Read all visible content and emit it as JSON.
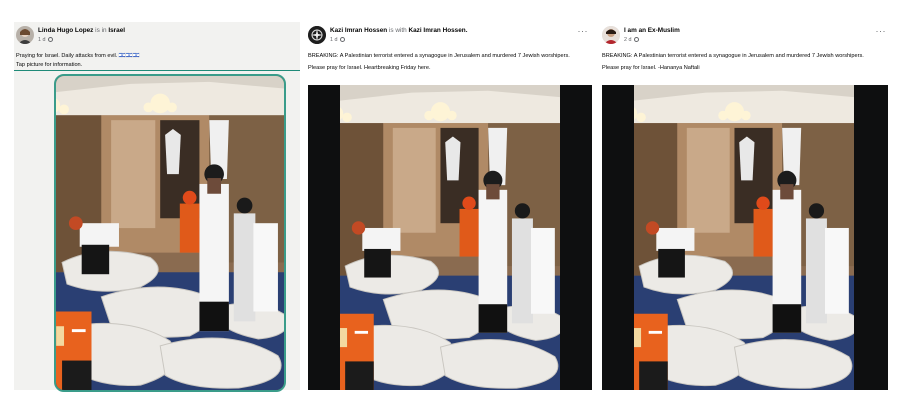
{
  "posts": [
    {
      "author": "Linda Hugo Lopez",
      "connector": "is in",
      "place": "Israel",
      "time": "1 d",
      "lines": [
        "Praying for Israel. Daily attacks from evil. 🇮🇱🇮🇱🇮🇱",
        "Tap picture for information."
      ],
      "flag_color": "#1877f2",
      "photo": "crime-scene-synagogue"
    },
    {
      "author": "Kazi Imran Hossen",
      "connector": "is with",
      "place": "Kazi Imran Hossen.",
      "time": "1 d",
      "lines": [
        "BREAKING: A Palestinian terrorist entered a synagogue in Jerusalem and murdered 7 Jewish worshipers.",
        "Please pray for Israel. Heartbreaking Friday here."
      ],
      "more": "···",
      "photo": "crime-scene-synagogue"
    },
    {
      "author": "I am an Ex-Muslim",
      "time": "2 d",
      "lines": [
        "BREAKING: A Palestinian terrorist entered a synagogue in Jerusalem and murdered 7 Jewish worshipers.",
        "Please pray for Israel. -Hananya Naftali"
      ],
      "more": "···",
      "photo": "crime-scene-synagogue"
    }
  ]
}
